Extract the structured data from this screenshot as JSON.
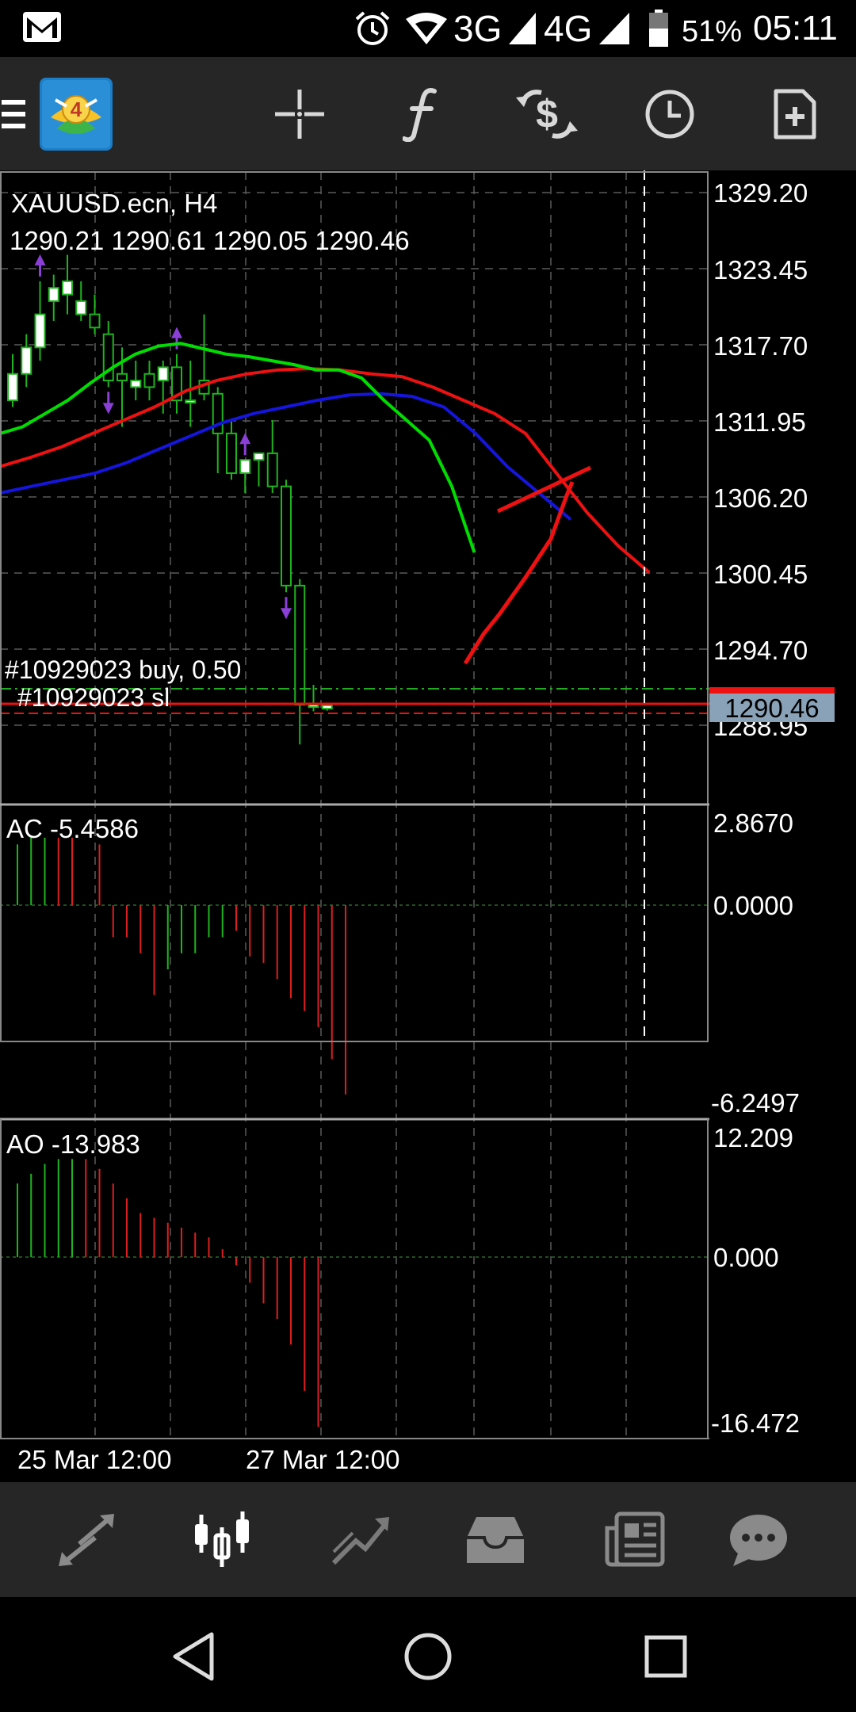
{
  "status_bar": {
    "mail_icon": "gmail-icon",
    "alarm_icon": "alarm-icon",
    "network_1": "3G",
    "network_2": "4G",
    "battery": "51%",
    "time": "05:11"
  },
  "toolbar": {
    "menu_icon": "hamburger-menu-icon",
    "app_logo": "metatrader-4-logo",
    "buttons": [
      {
        "name": "crosshair",
        "icon": "crosshair-icon"
      },
      {
        "name": "indicators",
        "icon": "function-f-icon"
      },
      {
        "name": "trade",
        "icon": "dollar-arrows-icon"
      },
      {
        "name": "timeframe",
        "icon": "clock-icon"
      },
      {
        "name": "new-order",
        "icon": "add-document-icon"
      }
    ]
  },
  "main_chart": {
    "symbol_label": "XAUUSD.ecn, H4",
    "ohlc_label": "1290.21 1290.61 1290.05 1290.46",
    "order_label": "#10929023 buy, 0.50",
    "sl_label": "#10929023 sl",
    "current_price": "1290.46",
    "price_scale": [
      "1329.20",
      "1323.45",
      "1317.70",
      "1311.95",
      "1306.20",
      "1300.45",
      "1294.70",
      "1288.95"
    ]
  },
  "ac_panel": {
    "label": "AC -5.4586",
    "scale": [
      "2.8670",
      "0.0000",
      "-6.2497"
    ]
  },
  "ao_panel": {
    "label": "AO -13.983",
    "scale": [
      "12.209",
      "0.000",
      "-16.472"
    ]
  },
  "time_axis": [
    "25 Mar 12:00",
    "27 Mar 12:00"
  ],
  "colors": {
    "bull": "#ffffff",
    "up_bar": "#1eb41e",
    "down_bar": "#dc1e1e",
    "ma_fast": "#00dd00",
    "ma_mid": "#ee1111",
    "ma_slow": "#1515dd",
    "grid": "#5a5a5a",
    "arrow": "#8a3fd6",
    "buy_line": "#22aa22",
    "sl_line": "#ee1111"
  },
  "chart_data": {
    "type": "candlestick",
    "symbol": "XAUUSD.ecn",
    "timeframe": "H4",
    "price_range": [
      1288.95,
      1329.2
    ],
    "candles": [
      {
        "o": 1313.5,
        "h": 1317.0,
        "l": 1313.0,
        "c": 1315.5
      },
      {
        "o": 1315.5,
        "h": 1318.5,
        "l": 1314.5,
        "c": 1317.5
      },
      {
        "o": 1317.5,
        "h": 1322.5,
        "l": 1316.5,
        "c": 1320.0
      },
      {
        "o": 1321.0,
        "h": 1323.0,
        "l": 1319.5,
        "c": 1322.0
      },
      {
        "o": 1321.5,
        "h": 1324.5,
        "l": 1320.0,
        "c": 1322.5
      },
      {
        "o": 1320.0,
        "h": 1322.5,
        "l": 1319.5,
        "c": 1321.0
      },
      {
        "o": 1320.0,
        "h": 1321.5,
        "l": 1318.5,
        "c": 1319.0
      },
      {
        "o": 1318.5,
        "h": 1319.5,
        "l": 1314.5,
        "c": 1315.0
      },
      {
        "o": 1315.5,
        "h": 1317.5,
        "l": 1311.5,
        "c": 1315.0
      },
      {
        "o": 1314.5,
        "h": 1316.5,
        "l": 1313.5,
        "c": 1315.0
      },
      {
        "o": 1315.5,
        "h": 1316.5,
        "l": 1313.5,
        "c": 1314.5
      },
      {
        "o": 1315.0,
        "h": 1316.5,
        "l": 1312.5,
        "c": 1316.0
      },
      {
        "o": 1316.0,
        "h": 1317.0,
        "l": 1312.5,
        "c": 1313.5
      },
      {
        "o": 1313.5,
        "h": 1316.5,
        "l": 1311.5,
        "c": 1313.5
      },
      {
        "o": 1315.0,
        "h": 1320.0,
        "l": 1313.5,
        "c": 1314.0
      },
      {
        "o": 1314.0,
        "h": 1314.5,
        "l": 1308.0,
        "c": 1311.0
      },
      {
        "o": 1311.0,
        "h": 1312.0,
        "l": 1307.5,
        "c": 1308.0
      },
      {
        "o": 1308.0,
        "h": 1309.0,
        "l": 1306.5,
        "c": 1309.0
      },
      {
        "o": 1309.0,
        "h": 1309.5,
        "l": 1307.0,
        "c": 1309.5
      },
      {
        "o": 1309.5,
        "h": 1312.0,
        "l": 1306.5,
        "c": 1307.0
      },
      {
        "o": 1307.0,
        "h": 1307.5,
        "l": 1299.0,
        "c": 1299.5
      },
      {
        "o": 1299.5,
        "h": 1300.0,
        "l": 1287.5,
        "c": 1290.5
      },
      {
        "o": 1290.5,
        "h": 1292.0,
        "l": 1290.0,
        "c": 1290.5
      },
      {
        "o": 1290.2,
        "h": 1290.6,
        "l": 1290.05,
        "c": 1290.46
      }
    ],
    "ma_fast": [
      1311.0,
      1311.5,
      1312.5,
      1313.5,
      1314.8,
      1316.0,
      1317.0,
      1317.6,
      1317.8,
      1317.4,
      1317.0,
      1316.8,
      1316.5,
      1316.2,
      1315.8,
      1315.8,
      1315.2,
      1313.5,
      1312.0,
      1310.5,
      1307.0,
      1302.0
    ],
    "ma_mid": [
      1308.5,
      1309.2,
      1310.0,
      1311.0,
      1312.0,
      1313.0,
      1314.2,
      1315.0,
      1315.5,
      1315.8,
      1315.9,
      1315.8,
      1315.5,
      1315.3,
      1314.5,
      1313.5,
      1312.5,
      1311.0,
      1308.0,
      1305.0,
      1302.5,
      1300.5
    ],
    "ma_slow": [
      1306.5,
      1307.0,
      1307.5,
      1308.0,
      1308.8,
      1309.8,
      1310.8,
      1311.8,
      1312.5,
      1313.0,
      1313.5,
      1313.9,
      1314.0,
      1313.8,
      1313.0,
      1311.0,
      1308.5,
      1306.5,
      1304.5
    ],
    "ac_range": [
      -6.2497,
      2.867
    ],
    "ac_values": [
      1.8,
      2.0,
      2.0,
      2.0,
      2.0,
      0.0,
      1.8,
      -1.0,
      -1.0,
      -1.5,
      -2.8,
      -2.0,
      -1.5,
      -1.5,
      -1.0,
      -1.0,
      -0.8,
      -1.6,
      -1.8,
      -2.3,
      -2.9,
      -3.3,
      -3.8,
      -4.8,
      -5.9
    ],
    "ac_colors": [
      "g",
      "g",
      "g",
      "r",
      "r",
      "g",
      "r",
      "r",
      "r",
      "r",
      "r",
      "g",
      "g",
      "g",
      "g",
      "g",
      "r",
      "r",
      "r",
      "r",
      "r",
      "r",
      "r",
      "r",
      "r"
    ],
    "ao_range": [
      -16.472,
      12.209
    ],
    "ao_values": [
      7.5,
      8.5,
      9.5,
      10.0,
      10.0,
      10.0,
      9.0,
      7.5,
      6.0,
      4.5,
      4.0,
      3.5,
      3.0,
      2.5,
      2.0,
      0.8,
      -0.8,
      -2.5,
      -4.5,
      -6.0,
      -8.5,
      -13.0,
      -16.5
    ],
    "ao_colors": [
      "g",
      "g",
      "g",
      "g",
      "g",
      "r",
      "r",
      "r",
      "r",
      "r",
      "r",
      "r",
      "r",
      "r",
      "r",
      "r",
      "r",
      "r",
      "r",
      "r",
      "r",
      "r",
      "r"
    ]
  }
}
